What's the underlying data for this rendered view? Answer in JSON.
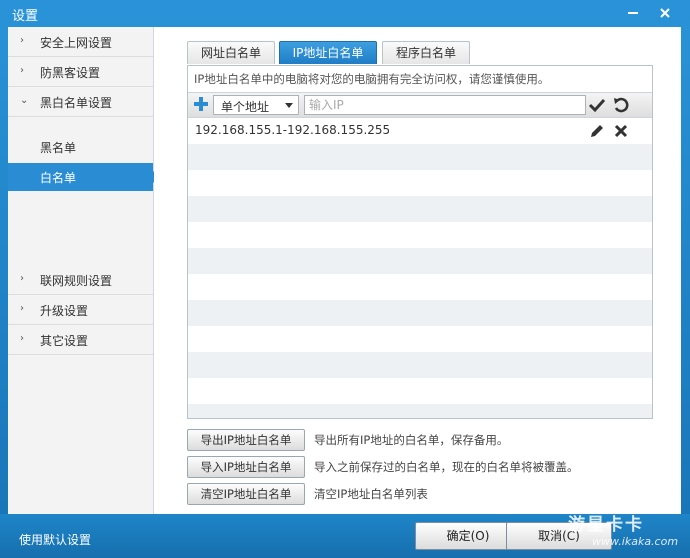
{
  "window": {
    "title": "设置"
  },
  "sidebar": {
    "items": [
      {
        "label": "安全上网设置",
        "arrow": "›"
      },
      {
        "label": "防黑客设置",
        "arrow": "›"
      },
      {
        "label": "黑白名单设置",
        "arrow": "⌄"
      },
      {
        "label": "联网规则设置",
        "arrow": "›"
      },
      {
        "label": "升级设置",
        "arrow": "›"
      },
      {
        "label": "其它设置",
        "arrow": "›"
      }
    ],
    "subitems": [
      {
        "label": "黑名单",
        "active": false
      },
      {
        "label": "白名单",
        "active": true
      }
    ]
  },
  "tabs": [
    {
      "label": "网址白名单",
      "active": false
    },
    {
      "label": "IP地址白名单",
      "active": true
    },
    {
      "label": "程序白名单",
      "active": false
    }
  ],
  "panel": {
    "description": "IP地址白名单中的电脑将对您的电脑拥有完全访问权，请您谨慎使用。",
    "select_value": "单个地址",
    "input_placeholder": "输入IP",
    "input_value": "",
    "rows": [
      {
        "text": "192.168.155.1-192.168.155.255"
      }
    ]
  },
  "actions": [
    {
      "button": "导出IP地址白名单",
      "desc": "导出所有IP地址的白名单，保存备用。"
    },
    {
      "button": "导入IP地址白名单",
      "desc": "导入之前保存过的白名单，现在的白名单将被覆盖。"
    },
    {
      "button": "清空IP地址白名单",
      "desc": "清空IP地址白名单列表"
    }
  ],
  "footer": {
    "default_link": "使用默认设置",
    "ok_label": "确定(O)",
    "cancel_label": "取消(C)"
  },
  "watermark": {
    "logo": "游星卡卡",
    "url": "www.ikaka.com"
  },
  "colors": {
    "accent": "#2a8dd4",
    "titlebar": "#1c7fc0"
  },
  "icons": [
    "minimize-icon",
    "close-icon",
    "add-icon",
    "check-icon",
    "undo-icon",
    "edit-icon",
    "delete-icon"
  ]
}
